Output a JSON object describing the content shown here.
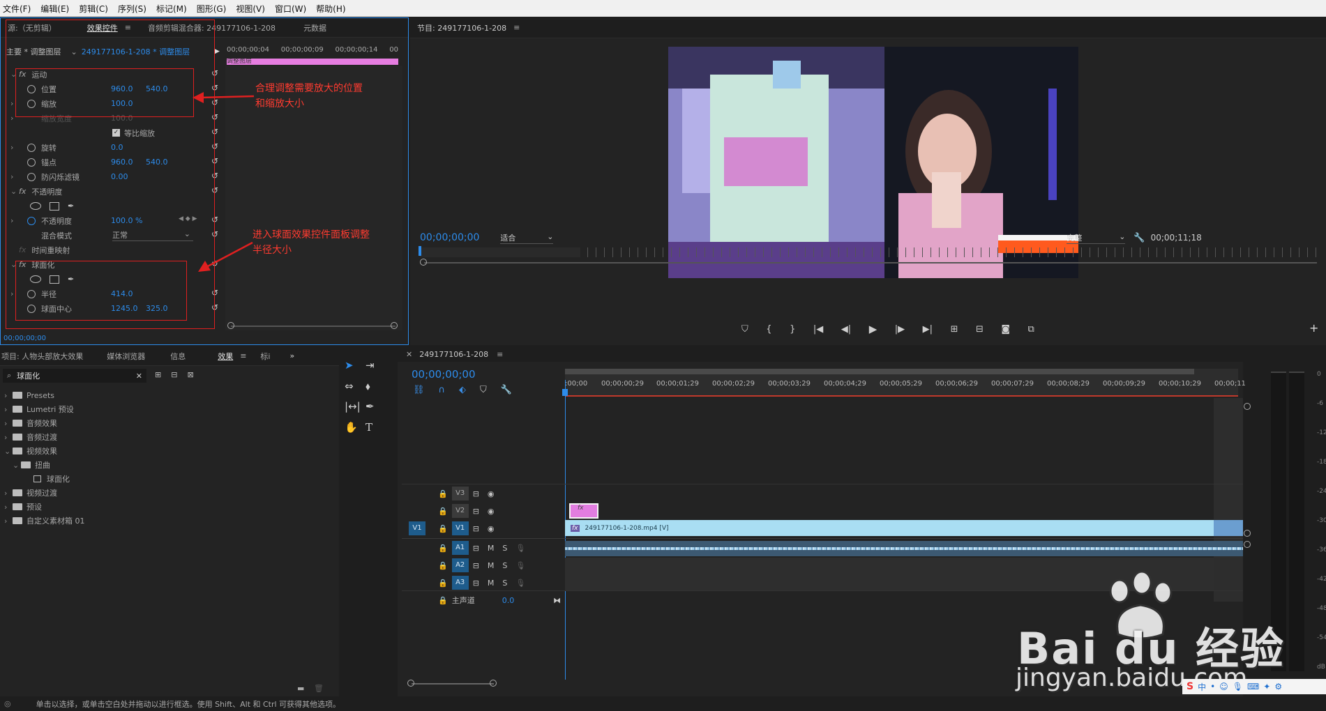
{
  "menu": [
    "文件(F)",
    "编辑(E)",
    "剪辑(C)",
    "序列(S)",
    "标记(M)",
    "图形(G)",
    "视图(V)",
    "窗口(W)",
    "帮助(H)"
  ],
  "source_panel": {
    "tabs": [
      "源:（无剪辑）",
      "效果控件",
      "音频剪辑混合器: 249177106-1-208",
      "元数据"
    ],
    "master_label": "主要 * 调整图层",
    "clip_label": "249177106-1-208 * 调整图层",
    "ruler": [
      "00;00;00;04",
      "00;00;00;09",
      "00;00;00;14",
      "00"
    ],
    "mini_clip": "调整图层",
    "timecode": "00;00;00;00"
  },
  "effects": {
    "motion": {
      "name": "运动",
      "position_label": "位置",
      "pos_x": "960.0",
      "pos_y": "540.0",
      "scale_label": "缩放",
      "scale": "100.0",
      "scale_width_label": "缩放宽度",
      "scale_width": "100.0",
      "uniform_label": "等比缩放",
      "rotation_label": "旋转",
      "rotation": "0.0",
      "anchor_label": "锚点",
      "anchor_x": "960.0",
      "anchor_y": "540.0",
      "flicker_label": "防闪烁滤镜",
      "flicker": "0.00"
    },
    "opacity": {
      "name": "不透明度",
      "opacity_label": "不透明度",
      "opacity": "100.0 %",
      "blend_label": "混合模式",
      "blend": "正常"
    },
    "time_remap": "时间重映射",
    "spherize": {
      "name": "球面化",
      "radius_label": "半径",
      "radius": "414.0",
      "center_label": "球面中心",
      "center_x": "1245.0",
      "center_y": "325.0"
    }
  },
  "annotations": {
    "note1": "合理调整需要放大的位置\n和缩放大小",
    "note2": "进入球面效果控件面板调整\n半径大小"
  },
  "program": {
    "title": "节目: 249177106-1-208",
    "timecode": "00;00;00;00",
    "fit": "适合",
    "quality": "完整",
    "duration": "00;00;11;18"
  },
  "project_panel": {
    "tabs": [
      "项目: 人物头部放大效果",
      "媒体浏览器",
      "信息",
      "效果",
      "标i"
    ],
    "search_value": "球面化",
    "tree": [
      {
        "label": "Presets",
        "depth": 0,
        "open": false
      },
      {
        "label": "Lumetri 预设",
        "depth": 0,
        "open": false
      },
      {
        "label": "音频效果",
        "depth": 0,
        "open": false
      },
      {
        "label": "音频过渡",
        "depth": 0,
        "open": false
      },
      {
        "label": "视频效果",
        "depth": 0,
        "open": true
      },
      {
        "label": "扭曲",
        "depth": 1,
        "open": true
      },
      {
        "label": "球面化",
        "depth": 2,
        "open": false
      },
      {
        "label": "视频过渡",
        "depth": 0,
        "open": false
      },
      {
        "label": "预设",
        "depth": 0,
        "open": false
      },
      {
        "label": "自定义素材箱 01",
        "depth": 0,
        "open": false
      }
    ]
  },
  "timeline": {
    "title": "249177106-1-208",
    "timecode": "00;00;00;00",
    "ruler": [
      ":00;00",
      "00;00;00;29",
      "00;00;01;29",
      "00;00;02;29",
      "00;00;03;29",
      "00;00;04;29",
      "00;00;05;29",
      "00;00;06;29",
      "00;00;07;29",
      "00;00;08;29",
      "00;00;09;29",
      "00;00;10;29",
      "00;00;11"
    ],
    "tracks": {
      "v3": "V3",
      "v2": "V2",
      "v1": "V1",
      "v1_src": "V1",
      "a1": "A1",
      "a2": "A2",
      "a3": "A3",
      "m": "M",
      "s": "S",
      "master": "主声道",
      "master_val": "0.0"
    },
    "fx_badge": "fx",
    "clip_name": "249177106-1-208.mp4 [V]"
  },
  "meter": [
    "0",
    "-6",
    "-12",
    "-18",
    "-24",
    "-30",
    "-36",
    "-42",
    "-48",
    "-54",
    "dB"
  ],
  "status": "单击以选择，或单击空白处并拖动以进行框选。使用 Shift、Alt 和 Ctrl 可获得其他选项。",
  "watermark": {
    "main": "Bai du 经验",
    "url": "jingyan.baidu.com"
  },
  "tray": "中"
}
